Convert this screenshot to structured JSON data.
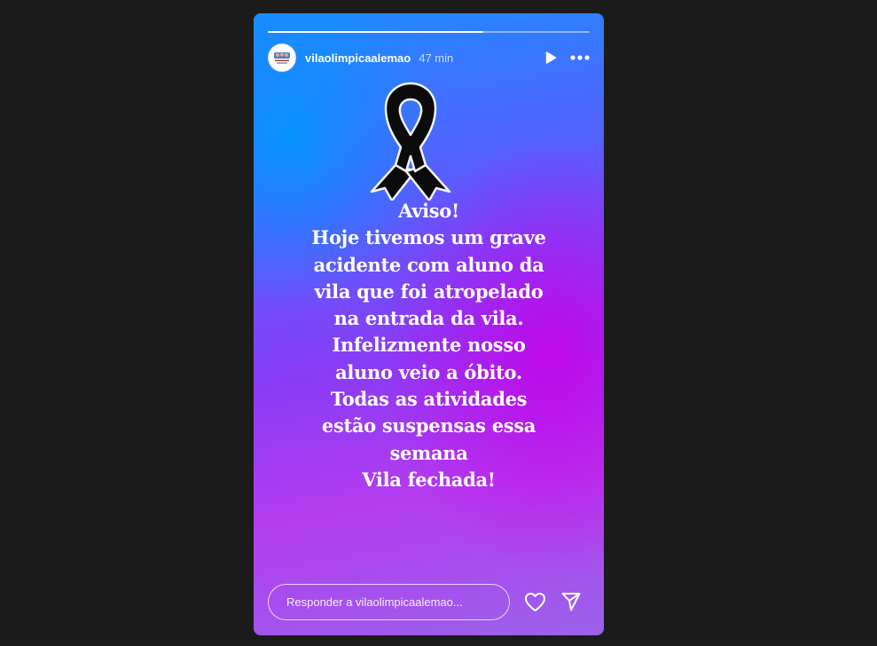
{
  "story": {
    "username": "vilaolimpicaalemao",
    "time_ago": "47 min",
    "progress": 0.67,
    "message_lines": [
      "Aviso!",
      "Hoje tivemos um grave",
      "acidente com aluno da",
      "vila que foi atropelado",
      "na entrada da vila.",
      "Infelizmente nosso",
      "aluno veio a óbito.",
      "Todas as atividades",
      "estão suspensas essa",
      "semana",
      "Vila fechada!"
    ],
    "reply_placeholder": "Responder a vilaolimpicaalemao..."
  },
  "icons": {
    "play": "play-icon",
    "more": "more-options-icon",
    "ribbon": "mourning-ribbon-icon",
    "like": "heart-icon",
    "share": "send-icon"
  },
  "colors": {
    "page_background": "#1b1b1b",
    "gradient": [
      "#1e8cff",
      "#8a3cf5",
      "#c800e6",
      "#9a62ea"
    ],
    "text": "#ffffff"
  }
}
